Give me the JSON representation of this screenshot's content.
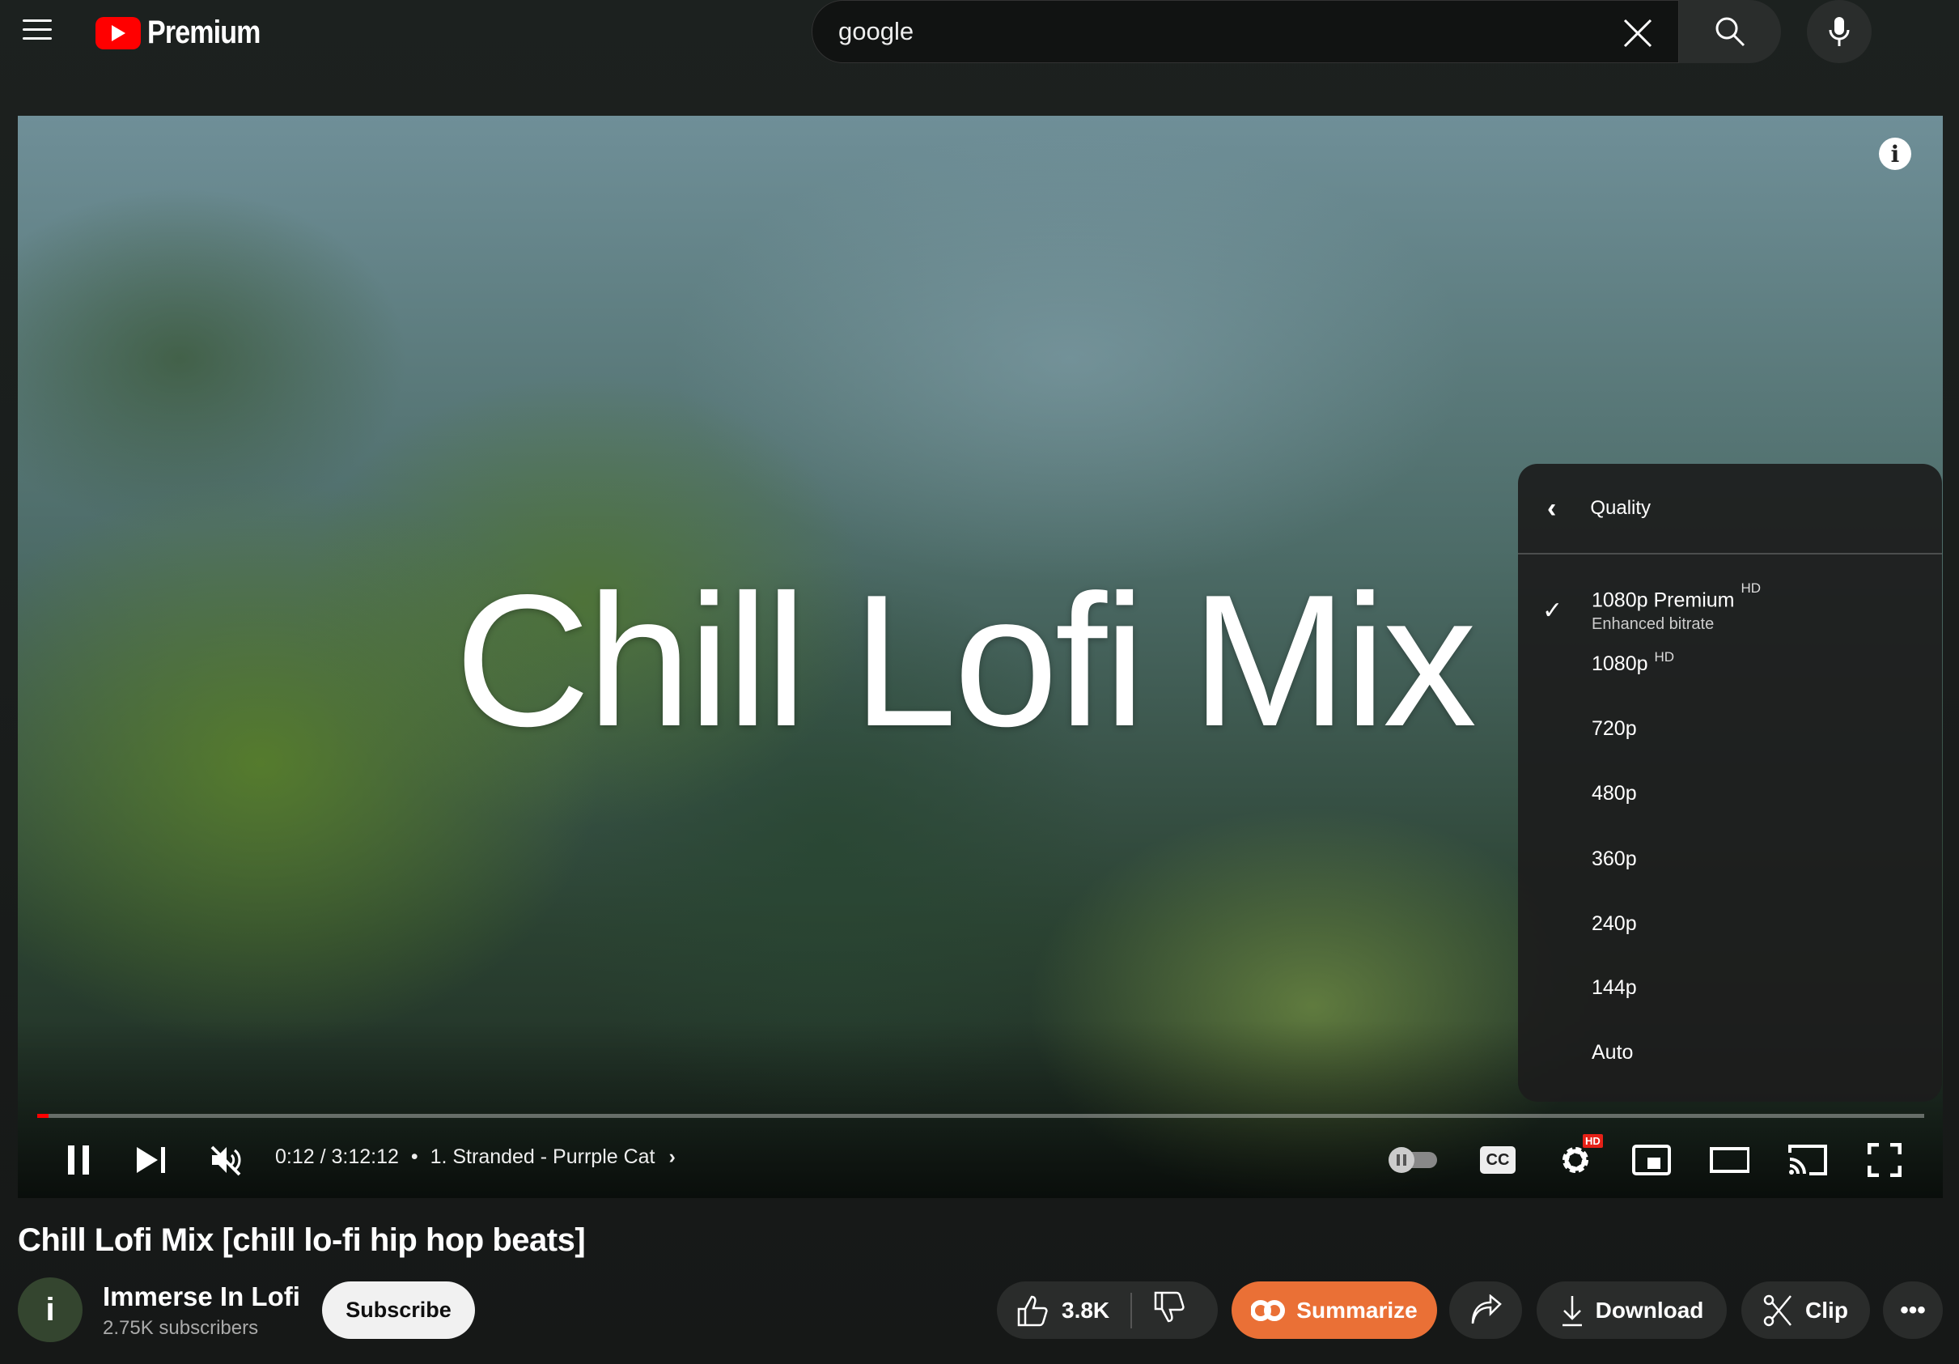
{
  "header": {
    "logo_text": "Premium",
    "search_value": "google"
  },
  "video": {
    "overlay_title": "Chill Lofi Mix",
    "progress_percent": 0.1,
    "time": "0:12 / 3:12:12",
    "separator": "•",
    "chapter": "1. Stranded - Purrple Cat",
    "settings_badge": "HD",
    "cc_label": "CC"
  },
  "quality_menu": {
    "title": "Quality",
    "items": [
      {
        "label": "1080p Premium",
        "badge": "HD",
        "sub": "Enhanced bitrate",
        "selected": true
      },
      {
        "label": "1080p",
        "badge": "HD"
      },
      {
        "label": "720p"
      },
      {
        "label": "480p"
      },
      {
        "label": "360p"
      },
      {
        "label": "240p"
      },
      {
        "label": "144p"
      },
      {
        "label": "Auto"
      }
    ]
  },
  "details": {
    "title": "Chill Lofi Mix [chill lo-fi hip hop beats]",
    "channel": "Immerse In Lofi",
    "avatar_letter": "i",
    "subscribers": "2.75K subscribers",
    "subscribe_label": "Subscribe",
    "likes": "3.8K",
    "summarize_label": "Summarize",
    "download_label": "Download",
    "clip_label": "Clip",
    "summarize_color": "#ea7036"
  }
}
